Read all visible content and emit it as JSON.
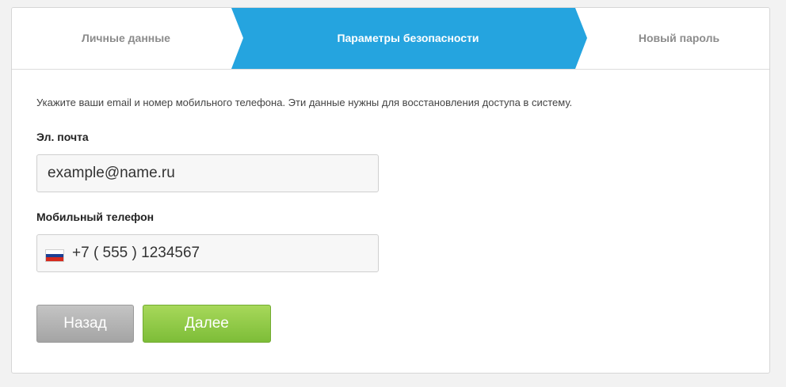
{
  "steps": [
    {
      "label": "Личные данные",
      "active": false
    },
    {
      "label": "Параметры безопасности",
      "active": true
    },
    {
      "label": "Новый пароль",
      "active": false
    }
  ],
  "intro_text": "Укажите ваши email и номер мобильного телефона. Эти данные нужны для восстановления доступа в систему.",
  "email": {
    "label": "Эл. почта",
    "placeholder": "example@name.ru"
  },
  "phone": {
    "label": "Мобильный телефон",
    "placeholder": "+7 ( 555 ) 1234567",
    "flag": "russia-flag-icon"
  },
  "buttons": {
    "back": "Назад",
    "next": "Далее"
  },
  "colors": {
    "active_step": "#25a4df",
    "next_button": "#8cc63f",
    "back_button": "#b3b3b3"
  }
}
